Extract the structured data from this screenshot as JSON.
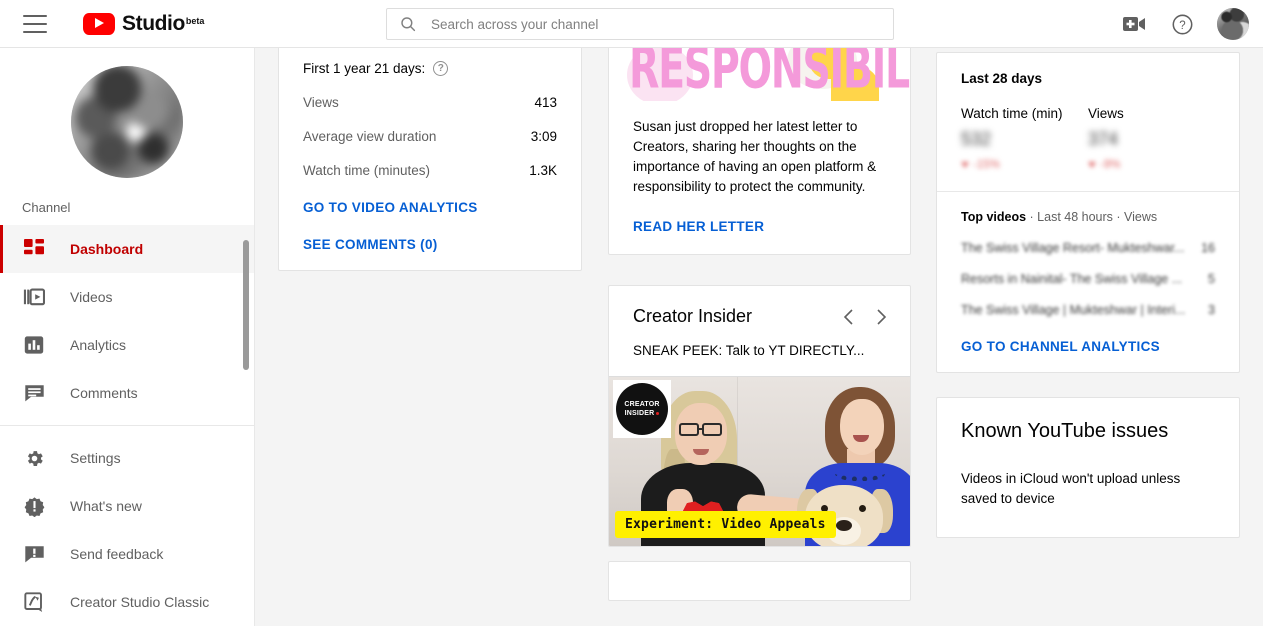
{
  "header": {
    "menu_label": "Menu",
    "brand": "Studio",
    "brand_suffix": "beta",
    "search_placeholder": "Search across your channel",
    "search_value": "",
    "create_label": "Create video or post",
    "help_label": "Help",
    "avatar_label": "Account"
  },
  "sidebar": {
    "section_label": "Channel",
    "items": [
      {
        "id": "dashboard",
        "label": "Dashboard",
        "icon": "dashboard-icon",
        "active": true
      },
      {
        "id": "videos",
        "label": "Videos",
        "icon": "videos-icon",
        "active": false
      },
      {
        "id": "analytics",
        "label": "Analytics",
        "icon": "analytics-icon",
        "active": false
      },
      {
        "id": "comments",
        "label": "Comments",
        "icon": "comments-icon",
        "active": false
      },
      {
        "id": "settings",
        "label": "Settings",
        "icon": "gear-icon",
        "active": false
      },
      {
        "id": "whats-new",
        "label": "What's new",
        "icon": "whats-new-icon",
        "active": false
      },
      {
        "id": "send-feedback",
        "label": "Send feedback",
        "icon": "feedback-icon",
        "active": false
      },
      {
        "id": "creator-studio-classic",
        "label": "Creator Studio Classic",
        "icon": "classic-icon",
        "active": false
      }
    ]
  },
  "latest_video_card": {
    "period_label": "First 1 year 21 days:",
    "help_icon_label": "?",
    "stats": [
      {
        "label": "Views",
        "value": "413"
      },
      {
        "label": "Average view duration",
        "value": "3:09"
      },
      {
        "label": "Watch time (minutes)",
        "value": "1.3K"
      }
    ],
    "links": [
      {
        "id": "go-to-video-analytics",
        "label": "GO TO VIDEO ANALYTICS"
      },
      {
        "id": "see-comments",
        "label": "SEE COMMENTS (0)"
      }
    ]
  },
  "news_card": {
    "banner_word": "RESPONSIBILITY",
    "body": "Susan just dropped her latest letter to Creators, sharing her thoughts on the importance of having an open platform & responsibility to protect the community.",
    "link_label": "READ HER LETTER"
  },
  "creator_insider_card": {
    "title": "Creator Insider",
    "prev_label": "Previous",
    "next_label": "Next",
    "video_title": "SNEAK PEEK: Talk to YT DIRECTLY...",
    "thumbnail_badge_line1": "CREATOR",
    "thumbnail_badge_line2": "INSIDER",
    "thumbnail_caption": "Experiment: Video Appeals"
  },
  "analytics_card": {
    "period_label": "Last 28 days",
    "metrics": [
      {
        "label": "Watch time (min)",
        "value": "532",
        "delta": "-15%"
      },
      {
        "label": "Views",
        "value": "374",
        "delta": "-9%"
      }
    ],
    "top_videos_heading_bold": "Top videos",
    "top_videos_heading_rest": " · Last 48 hours · Views",
    "top_videos": [
      {
        "title": "The Swiss Village Resort- Mukteshwar...",
        "views": "16"
      },
      {
        "title": "Resorts in Nainital- The Swiss Village ...",
        "views": "5"
      },
      {
        "title": "The Swiss Village | Mukteshwar | Interi...",
        "views": "3"
      }
    ],
    "link_label": "GO TO CHANNEL ANALYTICS"
  },
  "issues_card": {
    "title": "Known YouTube issues",
    "body": "Videos in iCloud won't upload unless saved to device"
  },
  "colors": {
    "accent_red": "#cc0000",
    "link_blue": "#065fd4",
    "background": "#f4f4f4",
    "card": "#ffffff",
    "caption_yellow": "#fff000"
  }
}
